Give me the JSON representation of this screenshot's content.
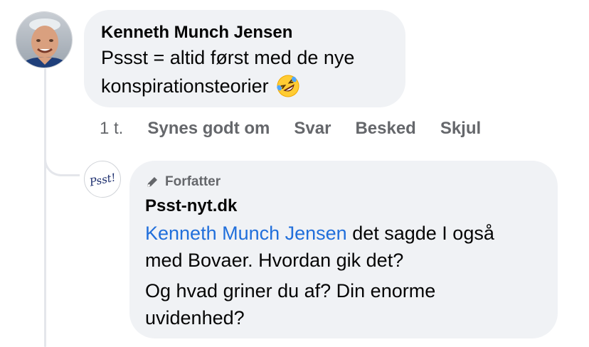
{
  "comment": {
    "author": "Kenneth Munch Jensen",
    "text_lines": [
      "Pssst = altid først med de nye",
      "konspirationsteorier"
    ],
    "emoji_icon": "rolling-on-floor-laughing-emoji",
    "time": "1 t.",
    "actions": {
      "like": "Synes godt om",
      "reply": "Svar",
      "message": "Besked",
      "hide": "Skjul"
    }
  },
  "reply": {
    "badge_label": "Forfatter",
    "badge_icon": "pen-icon",
    "author": "Psst-nyt.dk",
    "avatar_text": "Psst!",
    "mention": "Kenneth Munch Jensen",
    "text_after_mention": " det sagde I også",
    "text_lines": [
      "med Bovaer. Hvordan gik det?",
      "Og hvad griner du af? Din enorme",
      "uvidenhed?"
    ]
  },
  "colors": {
    "bubble": "#f0f2f5",
    "link": "#216fdb",
    "secondary_text": "#65676b",
    "thread_line": "#e4e6eb"
  }
}
